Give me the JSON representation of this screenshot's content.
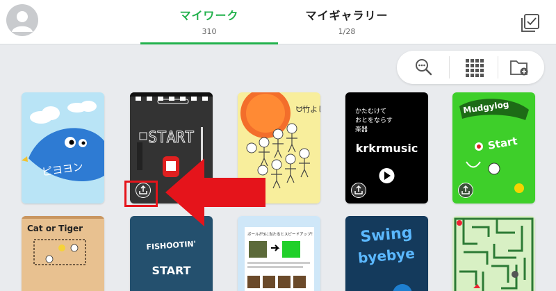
{
  "header": {
    "avatar_icon": "user-avatar-icon",
    "tabs": [
      {
        "label": "マイワーク",
        "count": "310",
        "active": true
      },
      {
        "label": "マイギャラリー",
        "count": "1/28",
        "active": false
      }
    ],
    "select_icon": "multi-select-checkbox-icon"
  },
  "toolbar": {
    "buttons": [
      {
        "icon": "search-zoom-icon"
      },
      {
        "icon": "grid-view-icon"
      },
      {
        "icon": "new-folder-icon"
      }
    ]
  },
  "works": [
    {
      "title_text": "ピヨヨン"
    },
    {
      "title_text": "START"
    },
    {
      "title_text": "ᗢ竹よし"
    },
    {
      "title_lines": [
        "かたむけて",
        "おとをならす",
        "楽器"
      ],
      "title_text": "krkrmusic"
    },
    {
      "title_text": "Mudgylog",
      "subtitle_text": "Start"
    },
    {
      "title_text": "Cat or Tiger"
    },
    {
      "title_text": "FISHOOTIN'",
      "subtitle_text": "START"
    },
    {
      "title_text": "ボールが3に当たるとスピードアップ！"
    },
    {
      "title_text": "Swing",
      "subtitle_text": "byebye"
    },
    {
      "title_text": "maze"
    }
  ],
  "colors": {
    "accent": "#22b14c",
    "annotation": "#e5141b"
  }
}
